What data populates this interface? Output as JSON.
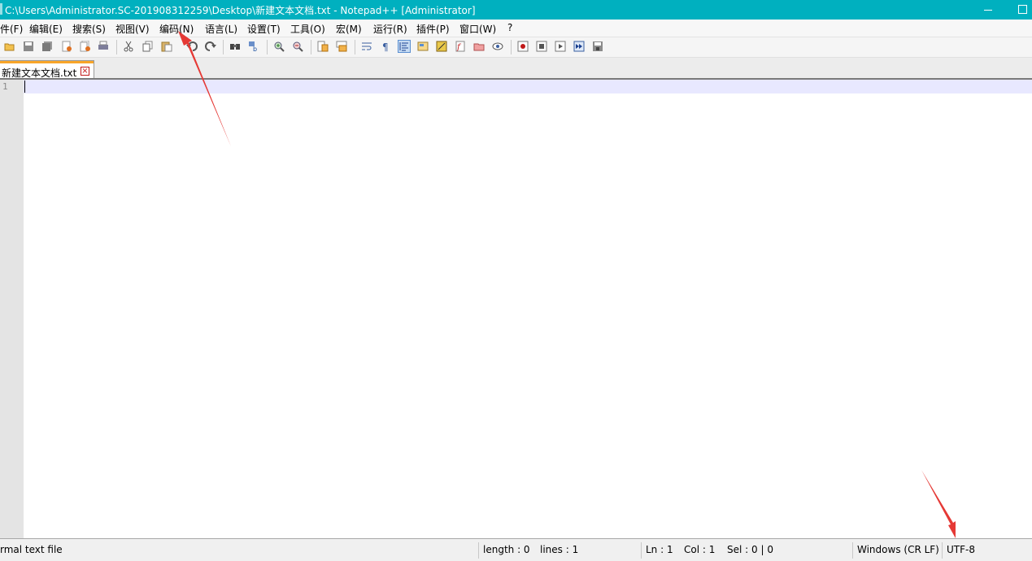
{
  "window": {
    "title": "C:\\Users\\Administrator.SC-201908312259\\Desktop\\新建文本文档.txt - Notepad++ [Administrator]"
  },
  "menu": {
    "items": [
      "件(F)",
      "编辑(E)",
      "搜索(S)",
      "视图(V)",
      "编码(N)",
      "语言(L)",
      "设置(T)",
      "工具(O)",
      "宏(M)",
      "运行(R)",
      "插件(P)",
      "窗口(W)",
      "?"
    ]
  },
  "toolbar": {
    "icons": [
      "open-file-icon",
      "save-icon",
      "save-all-icon",
      "close-icon",
      "close-all-icon",
      "print-icon",
      "cut-icon",
      "copy-icon",
      "paste-icon",
      "undo-icon",
      "redo-icon",
      "find-icon",
      "replace-icon",
      "zoom-in-icon",
      "zoom-out-icon",
      "sync-vertical-icon",
      "sync-horizontal-icon",
      "word-wrap-icon",
      "show-all-characters-icon",
      "indent-guide-icon",
      "user-defined-language-icon",
      "document-map-icon",
      "function-list-icon",
      "folder-as-workspace-icon",
      "monitoring-icon",
      "record-macro-icon",
      "stop-recording-icon",
      "playback-macro-icon",
      "run-macro-multiple-icon",
      "save-macro-icon"
    ]
  },
  "tabs": [
    {
      "label": "新建文本文档.txt",
      "active": true
    }
  ],
  "editor": {
    "line_numbers": [
      "1"
    ],
    "current_line_color": "#e8e8ff"
  },
  "status": {
    "file_type": "rmal text file",
    "length": "length : 0",
    "lines": "lines : 1",
    "ln": "Ln : 1",
    "col": "Col : 1",
    "sel": "Sel : 0 | 0",
    "eol": "Windows (CR LF)",
    "encoding": "UTF-8"
  },
  "colors": {
    "titlebar": "#00b0bf",
    "tab_accent": "#f8a529",
    "annotation_arrow": "#e53935"
  }
}
